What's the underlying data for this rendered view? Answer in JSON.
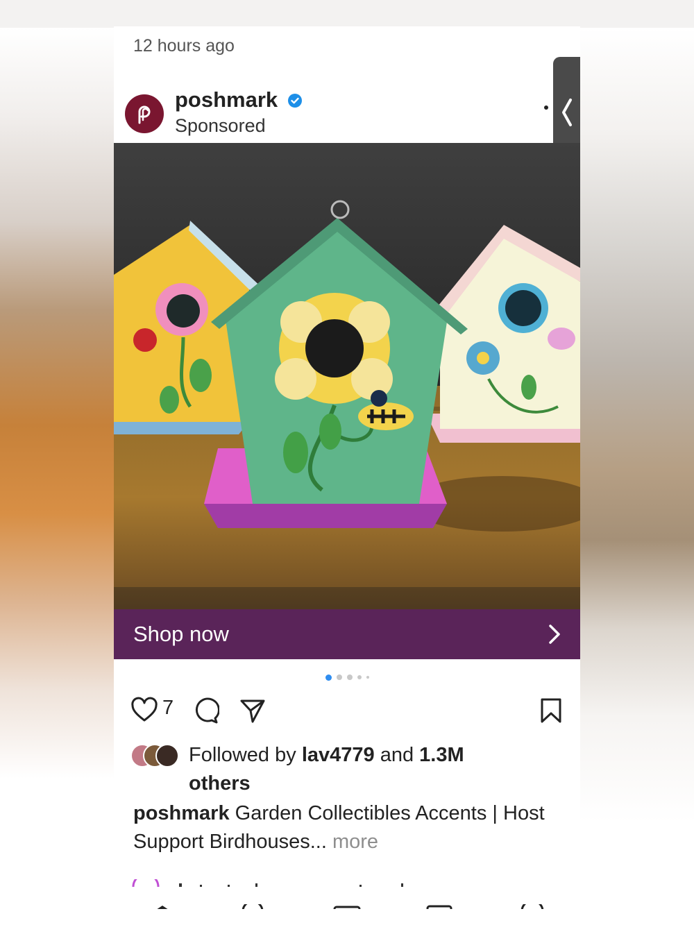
{
  "post": {
    "timestamp": "12 hours ago",
    "account": {
      "name": "poshmark",
      "verified": true,
      "label": "Sponsored",
      "avatar_color": "#7a1630",
      "verified_color": "#1d8fe8"
    },
    "image": {
      "description_icon": "birdhouses-photo",
      "carousel_total": 5,
      "carousel_active": 1
    },
    "cta": {
      "label": "Shop now",
      "color": "#5a2459"
    },
    "actions": {
      "like_count": "7"
    },
    "social_proof": {
      "text_prefix": "Followed by ",
      "user": "lav4779",
      "text_mid": " and ",
      "count": "1.3M",
      "text_suffix": "others"
    },
    "caption": {
      "user": "poshmark",
      "text": " Garden Collectibles Accents | Host Support Birdhouses...",
      "more": " more"
    }
  }
}
